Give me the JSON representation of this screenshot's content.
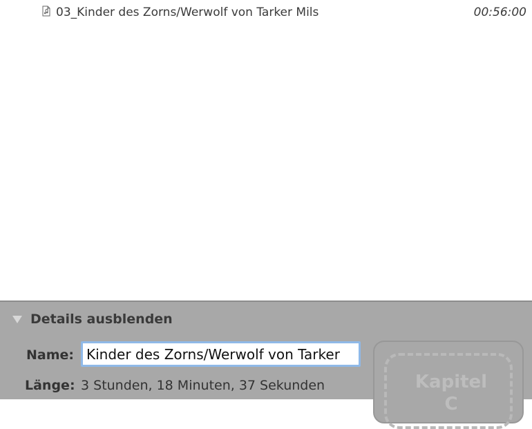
{
  "list": {
    "rows": [
      {
        "name": "03_Kinder des Zorns/Werwolf von Tarker Mils",
        "duration": "00:56:00",
        "icon": "audio-file-icon"
      }
    ]
  },
  "details": {
    "toggle_label": "Details ausblenden",
    "name_label": "Name:",
    "name_value": "Kinder des Zorns/Werwolf von Tarker",
    "length_label": "Länge:",
    "length_value": "3 Stunden, 18 Minuten, 37 Sekunden",
    "chapter_label_top": "Kapitel",
    "chapter_label_bottom": "C"
  },
  "colors": {
    "pane_background": "#a8a8a8",
    "input_focus_ring": "#8fb9e8"
  }
}
